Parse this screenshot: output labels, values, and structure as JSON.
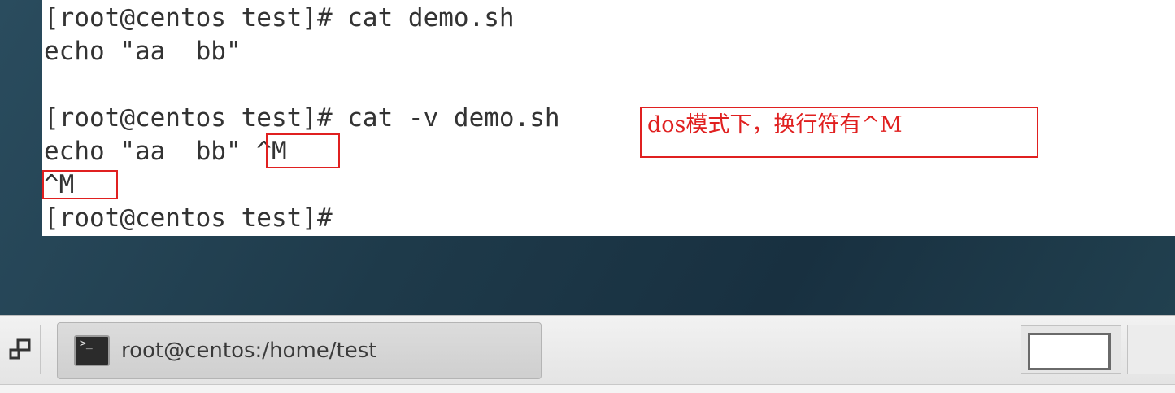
{
  "terminal": {
    "lines": [
      "[root@centos test]# cat demo.sh",
      "echo \"aa  bb\"",
      "",
      "[root@centos test]# cat -v demo.sh",
      "echo \"aa  bb\" ^M",
      "^M",
      "[root@centos test]#"
    ]
  },
  "annotation": {
    "note": "dos模式下，换行符有^M"
  },
  "taskbar": {
    "window_title": "root@centos:/home/test",
    "terminal_icon_glyph": ">_"
  },
  "colors": {
    "annotation_red": "#e02020",
    "terminal_text": "#333333",
    "terminal_bg": "#ffffff"
  }
}
